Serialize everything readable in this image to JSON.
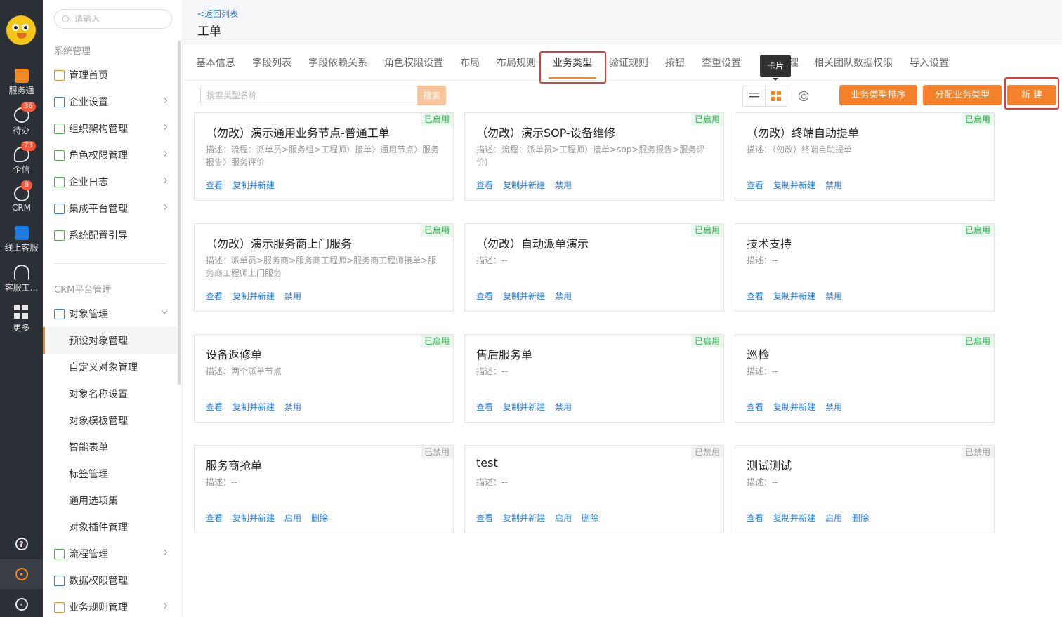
{
  "rail": {
    "items": [
      {
        "label": "服务通",
        "badge": ""
      },
      {
        "label": "待办",
        "badge": "36"
      },
      {
        "label": "企信",
        "badge": "73"
      },
      {
        "label": "CRM",
        "badge": "8"
      },
      {
        "label": "线上客服",
        "badge": ""
      },
      {
        "label": "客服工...",
        "badge": ""
      },
      {
        "label": "更多",
        "badge": ""
      }
    ]
  },
  "sidebar": {
    "search_placeholder": "请输入",
    "group1": "系统管理",
    "group2": "CRM平台管理",
    "items": [
      "管理首页",
      "企业设置",
      "组织架构管理",
      "角色权限管理",
      "企业日志",
      "集成平台管理",
      "系统配置引导",
      "对象管理",
      "预设对象管理",
      "自定义对象管理",
      "对象名称设置",
      "对象模板管理",
      "智能表单",
      "标签管理",
      "通用选项集",
      "对象插件管理",
      "流程管理",
      "数据权限管理",
      "业务规则管理"
    ]
  },
  "header": {
    "back_label": "<返回列表",
    "title": "工单"
  },
  "tabs": [
    "基本信息",
    "字段列表",
    "字段依赖关系",
    "角色权限设置",
    "布局",
    "布局规则",
    "业务类型",
    "验证规则",
    "按钮",
    "查重设置",
    "",
    "相关团队数据权限",
    "导入设置"
  ],
  "tab_partial_suffix": "理",
  "active_tab": "业务类型",
  "tooltip": "卡片",
  "toolbar": {
    "search_placeholder": "搜索类型名称",
    "search_button": "搜索",
    "sort_button": "业务类型排序",
    "assign_button": "分配业务类型",
    "new_button": "新 建"
  },
  "colors": {
    "accent": "#f5822a",
    "link": "#2a7ae2",
    "enabled": "#2bb24c",
    "highlight_box": "#e53935"
  },
  "cards": [
    {
      "title": "（勿改）演示通用业务节点-普通工单",
      "status": "已启用",
      "desc": "描述：流程：派单员>服务组>工程师）接单〉通用节点〉服务报告〉服务评价",
      "actions": [
        "查看",
        "复制并新建"
      ]
    },
    {
      "title": "（勿改）演示SOP-设备维修",
      "status": "已启用",
      "desc": "描述：流程：派单员>工程师）接单>sop>服务报告>服务评价)",
      "actions": [
        "查看",
        "复制并新建",
        "禁用"
      ]
    },
    {
      "title": "（勿改）终端自助提单",
      "status": "已启用",
      "desc": "描述：（勿改）终端自助提单",
      "actions": [
        "查看",
        "复制并新建",
        "禁用"
      ]
    },
    {
      "title": "（勿改）演示服务商上门服务",
      "status": "已启用",
      "desc": "描述：派单员>服务商>服务商工程师>服务商工程师接单>服务商工程师上门服务",
      "actions": [
        "查看",
        "复制并新建",
        "禁用"
      ]
    },
    {
      "title": "（勿改）自动派单演示",
      "status": "已启用",
      "desc": "描述：--",
      "actions": [
        "查看",
        "复制并新建",
        "禁用"
      ]
    },
    {
      "title": "技术支持",
      "status": "已启用",
      "desc": "描述：--",
      "actions": [
        "查看",
        "复制并新建",
        "禁用"
      ]
    },
    {
      "title": "设备返修单",
      "status": "已启用",
      "desc": "描述：两个派单节点",
      "actions": [
        "查看",
        "复制并新建",
        "禁用"
      ]
    },
    {
      "title": "售后服务单",
      "status": "已启用",
      "desc": "描述：--",
      "actions": [
        "查看",
        "复制并新建",
        "禁用"
      ]
    },
    {
      "title": "巡检",
      "status": "已启用",
      "desc": "描述：--",
      "actions": [
        "查看",
        "复制并新建",
        "禁用"
      ]
    },
    {
      "title": "服务商抢单",
      "status": "已禁用",
      "desc": "描述：--",
      "actions": [
        "查看",
        "复制并新建",
        "启用",
        "删除"
      ]
    },
    {
      "title": "test",
      "status": "已禁用",
      "desc": "描述：--",
      "actions": [
        "查看",
        "复制并新建",
        "启用",
        "删除"
      ]
    },
    {
      "title": "测试测试",
      "status": "已禁用",
      "desc": "描述：--",
      "actions": [
        "查看",
        "复制并新建",
        "启用",
        "删除"
      ]
    }
  ]
}
